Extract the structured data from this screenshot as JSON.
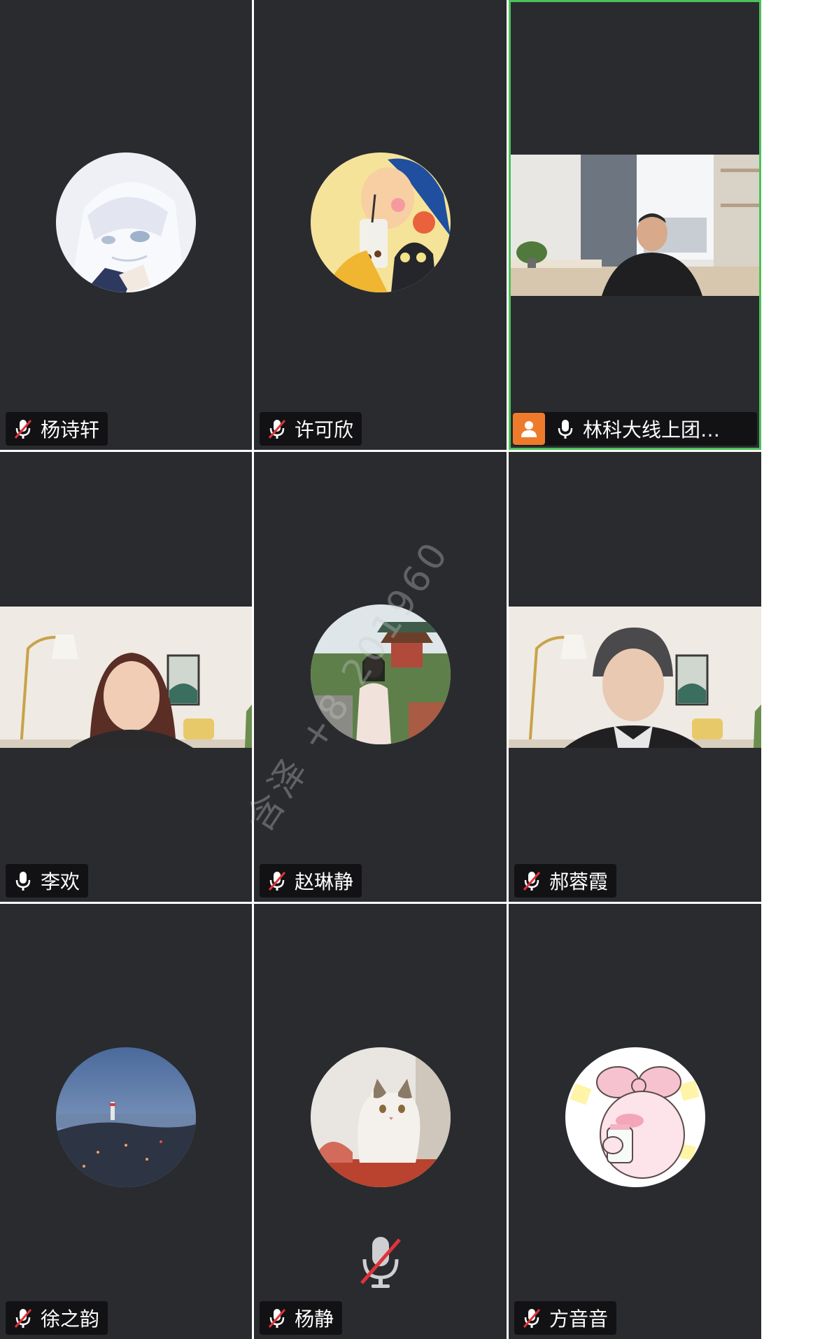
{
  "participants": [
    {
      "name": "杨诗轩",
      "mic": "muted",
      "display": "avatar",
      "avatar": "anime-white-hair-avatar"
    },
    {
      "name": "许可欣",
      "mic": "muted",
      "display": "avatar",
      "avatar": "cartoon-girl-boba-cat-avatar"
    },
    {
      "name": "林科大线上团…",
      "mic": "on",
      "display": "video",
      "host": true,
      "active_speaker": true,
      "video": "man-in-room-video"
    },
    {
      "name": "李欢",
      "mic": "on",
      "display": "video",
      "video": "woman-living-room-video"
    },
    {
      "name": "赵琳静",
      "mic": "muted",
      "display": "avatar",
      "avatar": "woman-temple-photo-avatar"
    },
    {
      "name": "郝蓉霞",
      "mic": "muted",
      "display": "video",
      "video": "woman-living-room-video-2"
    },
    {
      "name": "徐之韵",
      "mic": "muted",
      "display": "avatar",
      "avatar": "coastal-town-dusk-avatar"
    },
    {
      "name": "杨静",
      "mic": "muted",
      "display": "avatar",
      "avatar": "cat-photo-avatar",
      "center_muted_icon": true
    },
    {
      "name": "方音音",
      "mic": "muted",
      "display": "avatar",
      "avatar": "pink-bunny-cartoon-avatar"
    }
  ],
  "watermark": "含泽 +8 201960",
  "colors": {
    "tile_bg": "#2a2b2f",
    "active_border": "#4cc15a",
    "host_badge": "#ee7b2c",
    "muted_slash": "#e0333a"
  }
}
